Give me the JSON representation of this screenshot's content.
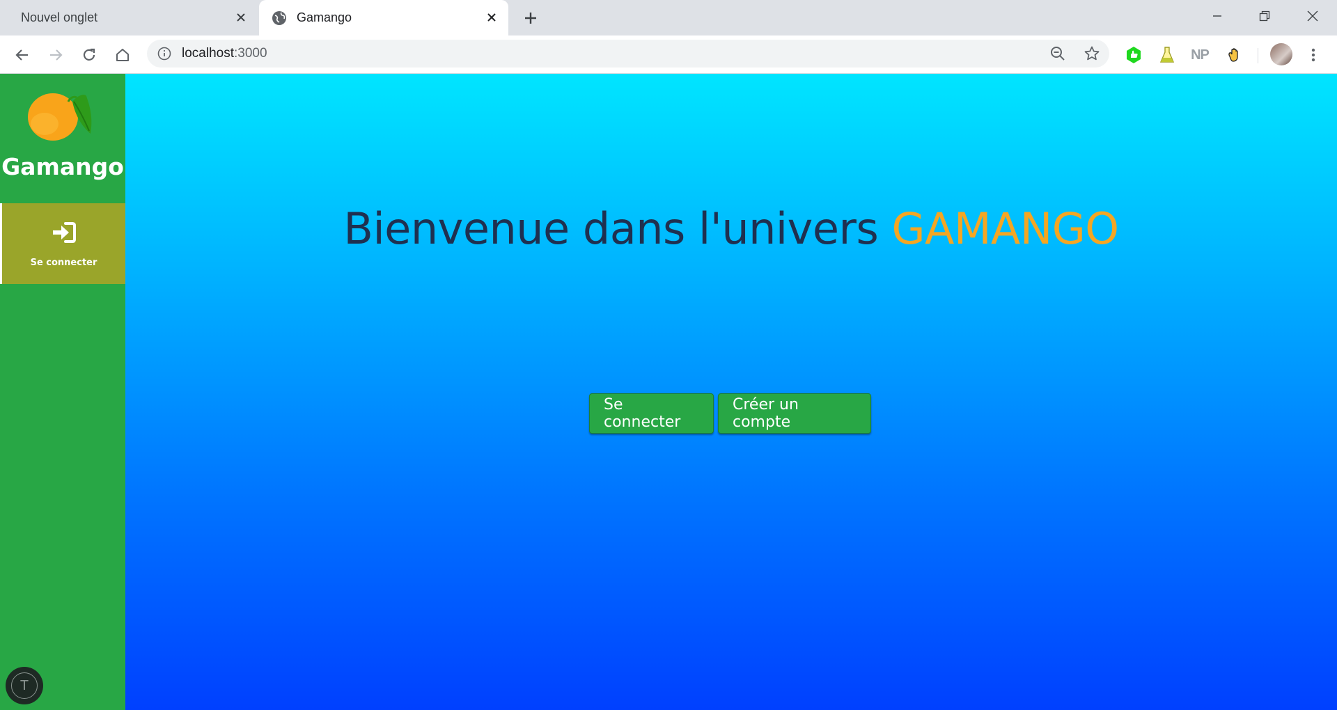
{
  "browser": {
    "tabs": [
      {
        "title": "Nouvel onglet",
        "active": false
      },
      {
        "title": "Gamango",
        "active": true
      }
    ],
    "address": {
      "host": "localhost",
      "port": ":3000"
    },
    "extensions": [
      "green-extension-icon",
      "flask-extension-icon",
      "NP",
      "hand-extension-icon"
    ]
  },
  "sidebar": {
    "brand": "Gamango",
    "nav": [
      {
        "label": "Se connecter",
        "icon": "sign-in-icon"
      }
    ],
    "user_initial": "T"
  },
  "main": {
    "headline_prefix": "Bienvenue dans l'univers",
    "headline_accent": "GAMANGO",
    "buttons": {
      "login": "Se connecter",
      "register": "Créer un compte"
    }
  },
  "colors": {
    "sidebar": "#28a745",
    "nav_active": "#9aa52a",
    "accent": "#f5a623",
    "headline": "#1f3050",
    "button": "#28a745"
  }
}
